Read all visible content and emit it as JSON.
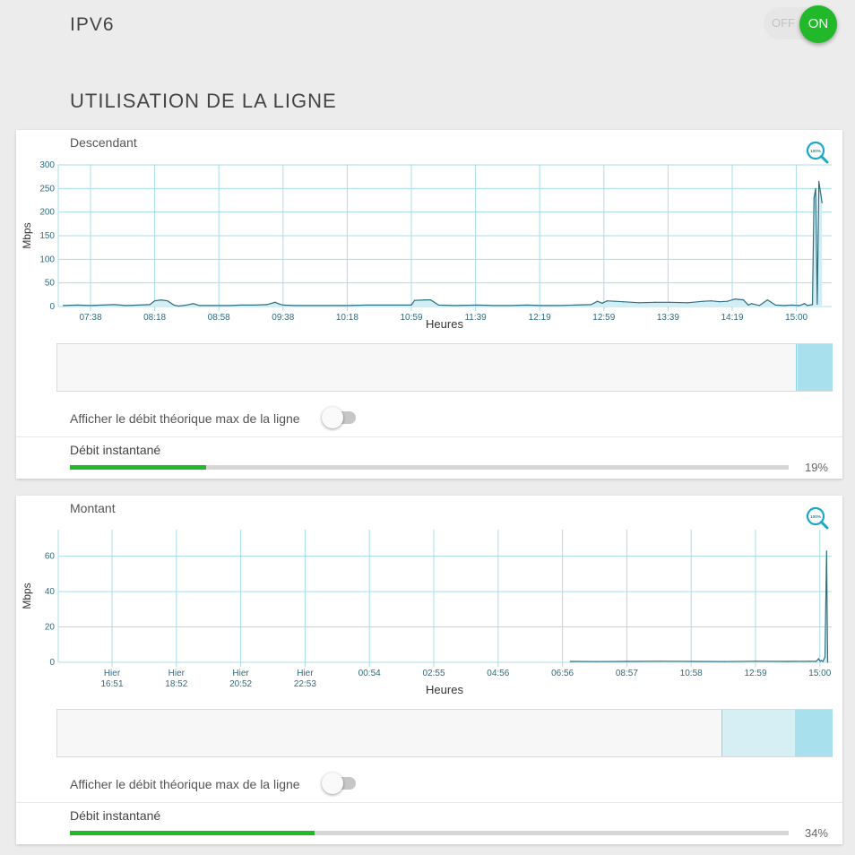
{
  "ipv6": {
    "title": "IPV6",
    "toggle_off": "OFF",
    "toggle_on": "ON",
    "state": "on"
  },
  "section_title": "UTILISATION DE LA LIGNE",
  "colors": {
    "accent": "#21b82a",
    "chart_line": "#2e6f80",
    "chart_fill": "#d3edf4",
    "grid": "#a8dde8",
    "nav_fill": "#a9e0ed"
  },
  "icons": {
    "zoom": "zoom-100-percent-icon"
  },
  "download": {
    "label": "Descendant",
    "zoom_text": "100%",
    "toggle_label": "Afficher le débit théorique max de la ligne",
    "toggle_state": "off",
    "inst_label": "Débit instantané",
    "percent_text": "19%",
    "percent": 19
  },
  "upload": {
    "label": "Montant",
    "zoom_text": "100%",
    "toggle_label": "Afficher le débit théorique max de la ligne",
    "toggle_state": "off",
    "inst_label": "Débit instantané",
    "percent_text": "34%",
    "percent": 34
  },
  "chart_data": [
    {
      "type": "area",
      "ylabel": "Mbps",
      "xlabel": "Heures",
      "ylim": [
        0,
        300
      ],
      "yticks": [
        "0",
        "50",
        "100",
        "150",
        "200",
        "250",
        "300"
      ],
      "xticks": [
        [
          "07:38"
        ],
        [
          "08:18"
        ],
        [
          "08:58"
        ],
        [
          "09:38"
        ],
        [
          "10:18"
        ],
        [
          "10:59"
        ],
        [
          "11:39"
        ],
        [
          "12:19"
        ],
        [
          "12:59"
        ],
        [
          "13:39"
        ],
        [
          "14:19"
        ],
        [
          "15:00"
        ]
      ],
      "grid": true,
      "x": [
        "07:21",
        "07:30",
        "07:38",
        "07:45",
        "07:53",
        "08:00",
        "08:08",
        "08:15",
        "08:18",
        "08:22",
        "08:26",
        "08:30",
        "08:33",
        "08:38",
        "08:42",
        "08:46",
        "08:50",
        "08:58",
        "09:05",
        "09:12",
        "09:20",
        "09:28",
        "09:33",
        "09:36",
        "09:38",
        "09:45",
        "09:55",
        "10:05",
        "10:18",
        "10:30",
        "10:45",
        "10:58",
        "11:00",
        "11:07",
        "11:10",
        "11:15",
        "11:25",
        "11:39",
        "11:50",
        "12:00",
        "12:10",
        "12:19",
        "12:30",
        "12:40",
        "12:50",
        "12:54",
        "12:57",
        "13:00",
        "13:05",
        "13:10",
        "13:20",
        "13:30",
        "13:39",
        "13:50",
        "14:00",
        "14:05",
        "14:10",
        "14:15",
        "14:19",
        "14:20",
        "14:22",
        "14:25",
        "14:28",
        "14:30",
        "14:35",
        "14:40",
        "14:45",
        "14:50",
        "14:55",
        "15:00",
        "15:03",
        "15:05",
        "15:08",
        "15:09",
        "15:10",
        "15:11",
        "15:12",
        "15:14"
      ],
      "values": [
        2,
        3,
        2,
        3,
        4,
        2,
        3,
        4,
        12,
        14,
        12,
        3,
        1,
        3,
        6,
        2,
        2,
        2,
        2,
        3,
        3,
        4,
        9,
        5,
        3,
        2,
        2,
        2,
        2,
        3,
        3,
        3,
        13,
        14,
        14,
        3,
        2,
        3,
        2,
        2,
        3,
        2,
        2,
        3,
        4,
        11,
        7,
        12,
        11,
        10,
        8,
        9,
        9,
        8,
        11,
        12,
        10,
        11,
        15,
        16,
        15,
        14,
        3,
        6,
        2,
        14,
        3,
        2,
        3,
        2,
        6,
        2,
        4,
        230,
        250,
        5,
        265,
        220
      ]
    },
    {
      "type": "area",
      "ylabel": "Mbps",
      "xlabel": "Heures",
      "ylim": [
        0,
        75
      ],
      "yticks": [
        "0",
        "20",
        "40",
        "60"
      ],
      "xticks": [
        [
          "Hier",
          "16:51"
        ],
        [
          "Hier",
          "18:52"
        ],
        [
          "Hier",
          "20:52"
        ],
        [
          "Hier",
          "22:53"
        ],
        [
          "00:54"
        ],
        [
          "02:55"
        ],
        [
          "04:56"
        ],
        [
          "06:56"
        ],
        [
          "08:57"
        ],
        [
          "10:58"
        ],
        [
          "12:59"
        ],
        [
          "15:00"
        ]
      ],
      "grid": true,
      "x": [
        "07:10",
        "08:00",
        "09:00",
        "10:00",
        "11:00",
        "12:00",
        "13:00",
        "14:00",
        "14:40",
        "14:52",
        "14:57",
        "15:00",
        "15:02",
        "15:05",
        "15:09",
        "15:12",
        "15:14"
      ],
      "values": [
        0.5,
        0.4,
        0.5,
        0.6,
        0.5,
        0.4,
        0.6,
        0.5,
        0.6,
        0.5,
        2,
        0.6,
        1,
        0.5,
        3,
        63,
        0
      ]
    }
  ]
}
